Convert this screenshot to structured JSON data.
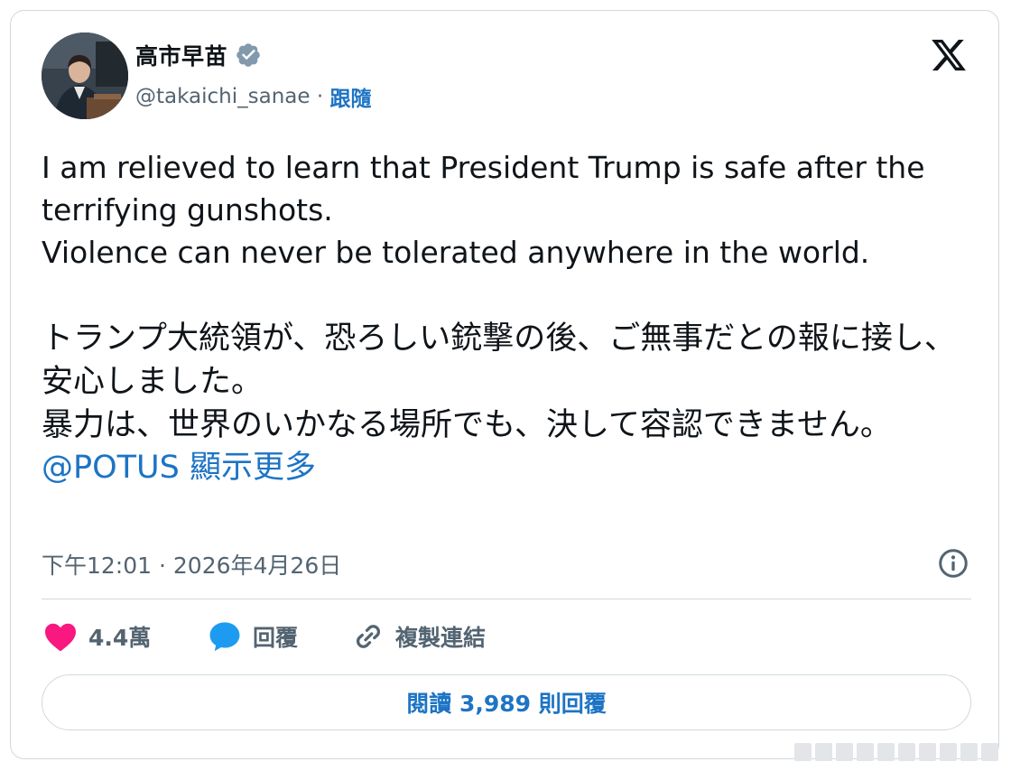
{
  "author": {
    "display_name": "高市早苗",
    "handle": "@takaichi_sanae",
    "separator": " · ",
    "follow_label": "跟隨",
    "verified_icon": "verified-badge-icon",
    "avatar_icon": "avatar-photo"
  },
  "tweet": {
    "lines_en_1": "I am relieved to learn that President Trump is safe after the terrifying gunshots.",
    "lines_en_2": "Violence can never be tolerated anywhere in the world.",
    "lines_ja_1": "トランプ大統領が、恐ろしい銃撃の後、ご無事だとの報に接し、安心しました。",
    "lines_ja_2": "暴力は、世界のいかなる場所でも、決して容認できません。",
    "mention": "@POTUS",
    "show_more": "顯示更多"
  },
  "meta": {
    "timestamp": "下午12:01 · 2026年4月26日"
  },
  "actions": {
    "like_count": "4.4萬",
    "reply_label": "回覆",
    "copy_link_label": "複製連結"
  },
  "read_replies_label": "閱讀 3,989 則回覆",
  "colors": {
    "accent": "#1d74c4",
    "like": "#f91880",
    "reply": "#1d9bf0",
    "text": "#0f1419",
    "muted": "#536471",
    "border": "#cfd9de"
  }
}
